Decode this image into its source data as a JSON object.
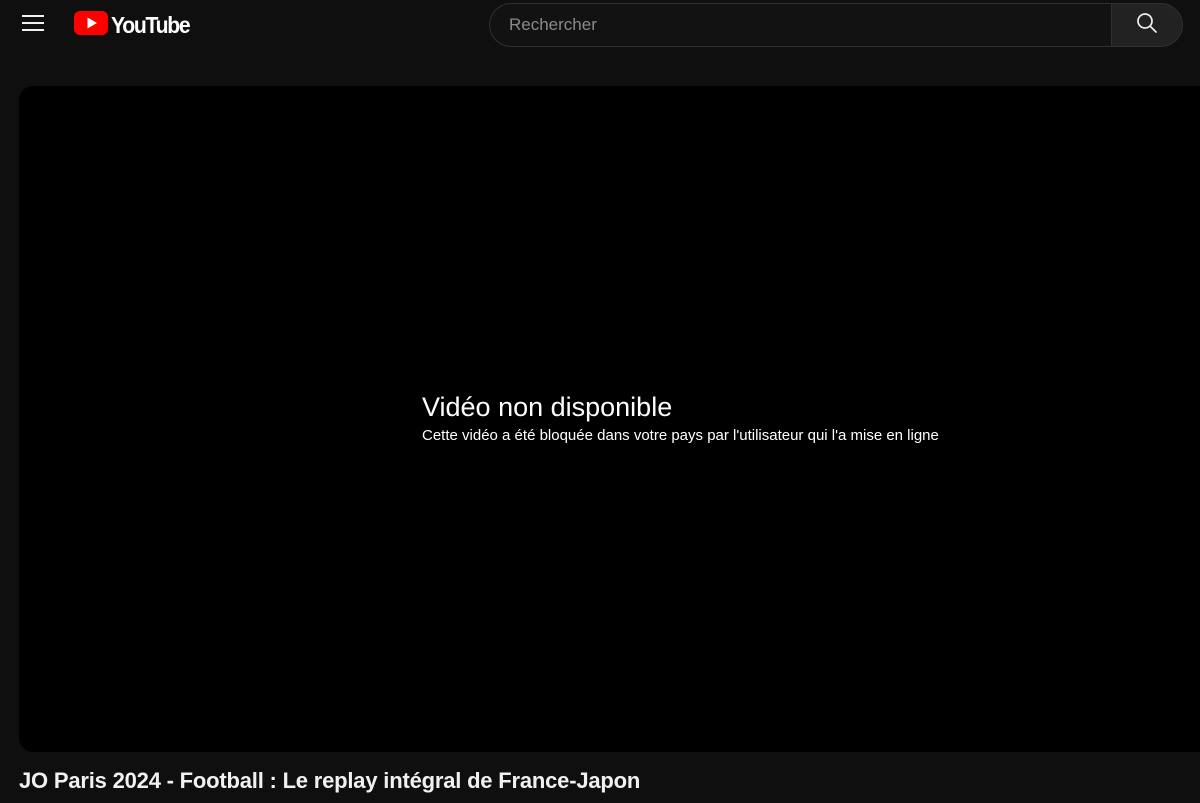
{
  "header": {
    "menu_icon": "hamburger-menu-icon",
    "logo": {
      "icon": "youtube-play-icon",
      "text": "YouTube",
      "brand_color": "#ff0000"
    },
    "search": {
      "placeholder": "Rechercher",
      "value": "",
      "button_icon": "search-icon"
    }
  },
  "player": {
    "error_title": "Vidéo non disponible",
    "error_reason": "Cette vidéo a été bloquée dans votre pays par l'utilisateur qui l'a mise en ligne"
  },
  "video": {
    "title": "JO Paris 2024 - Football : Le replay intégral de France-Japon"
  },
  "colors": {
    "page_background": "#0f0f0f",
    "player_background": "#000000",
    "text": "#f1f1f1"
  }
}
